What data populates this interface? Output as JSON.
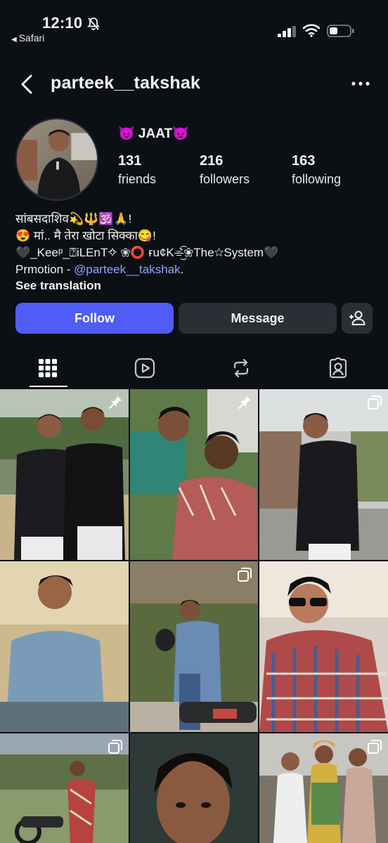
{
  "status_bar": {
    "time": "12:10",
    "back_app": "Safari",
    "icons": [
      "bell-slash-icon",
      "signal-icon",
      "wifi-icon",
      "battery-icon"
    ]
  },
  "header": {
    "username": "parteek__takshak",
    "icons": [
      "chevron-left-icon",
      "more-horizontal-icon"
    ]
  },
  "profile": {
    "display_name": "😈 JAAT😈",
    "stats": [
      {
        "value": "131",
        "label": "friends"
      },
      {
        "value": "216",
        "label": "followers"
      },
      {
        "value": "163",
        "label": "following"
      }
    ],
    "bio_lines": [
      "सांबसदाशिव💫🔱🕉️🙏!",
      "😍 मां.. मै तेरा खोटा सिक्का😋!",
      "🖤_Keeᵖ_⍰iLEnT✧ ❀⭕ ғu¢K⌯͛͜͡❀The☆System🖤"
    ],
    "promotion_prefix": "Prmotion - ",
    "promotion_handle": "@parteek__takshak",
    "promotion_suffix": ".",
    "see_translation": "See translation"
  },
  "actions": {
    "follow": "Follow",
    "message": "Message",
    "add_user_icon": "add-user-icon"
  },
  "tabs": [
    {
      "name": "grid",
      "icon": "grid-icon",
      "active": true
    },
    {
      "name": "reels",
      "icon": "reels-icon",
      "active": false
    },
    {
      "name": "reposts",
      "icon": "repost-icon",
      "active": false
    },
    {
      "name": "tagged",
      "icon": "tagged-icon",
      "active": false
    }
  ],
  "colors": {
    "background": "#0c1015",
    "follow_button": "#4f5cf5",
    "secondary_button": "#2a2f36",
    "link": "#8ea2ff"
  },
  "posts": [
    {
      "badge": "pin-icon"
    },
    {
      "badge": "pin-icon"
    },
    {
      "badge": "carousel-icon"
    },
    {
      "badge": ""
    },
    {
      "badge": "carousel-icon"
    },
    {
      "badge": ""
    },
    {
      "badge": "carousel-icon"
    },
    {
      "badge": ""
    },
    {
      "badge": "carousel-icon"
    }
  ]
}
